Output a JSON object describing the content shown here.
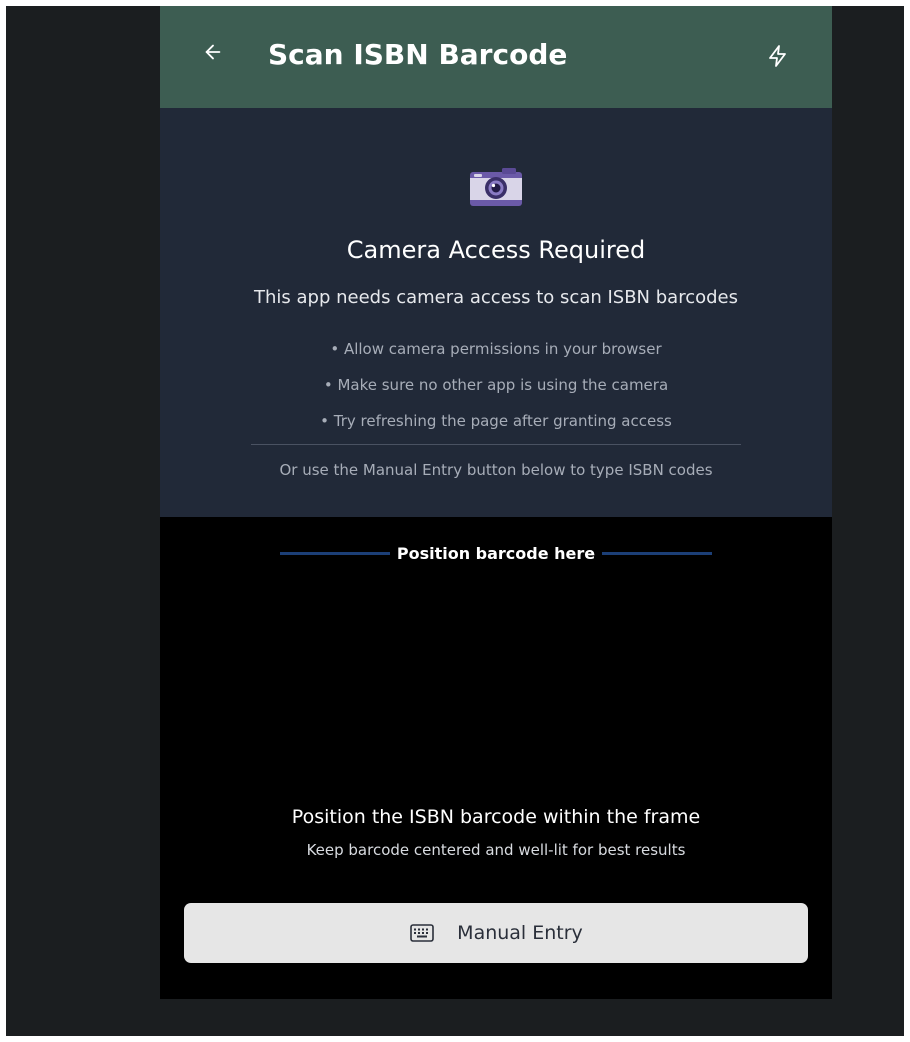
{
  "header": {
    "title": "Scan ISBN Barcode",
    "back_icon": "arrow-left-icon",
    "flash_icon": "lightning-icon"
  },
  "permission_notice": {
    "icon": "camera-icon",
    "title": "Camera Access Required",
    "subtitle": "This app needs camera access to scan ISBN barcodes",
    "tips": [
      "• Allow camera permissions in your browser",
      "• Make sure no other app is using the camera",
      "• Try refreshing the page after granting access"
    ],
    "manual_hint": "Or use the Manual Entry button below to type ISBN codes"
  },
  "scanner": {
    "frame_label": "Position barcode here",
    "instruction_title": "Position the ISBN barcode within the frame",
    "instruction_subtitle": "Keep barcode centered and well-lit for best results"
  },
  "manual_entry": {
    "icon": "keyboard-icon",
    "label": "Manual Entry"
  },
  "colors": {
    "header_bg": "#3d5d52",
    "notice_bg": "#212938",
    "scanner_bg": "#000000",
    "frame_line": "#1c3f77",
    "button_bg": "#e6e6e6",
    "page_bg": "#1b1e20"
  }
}
